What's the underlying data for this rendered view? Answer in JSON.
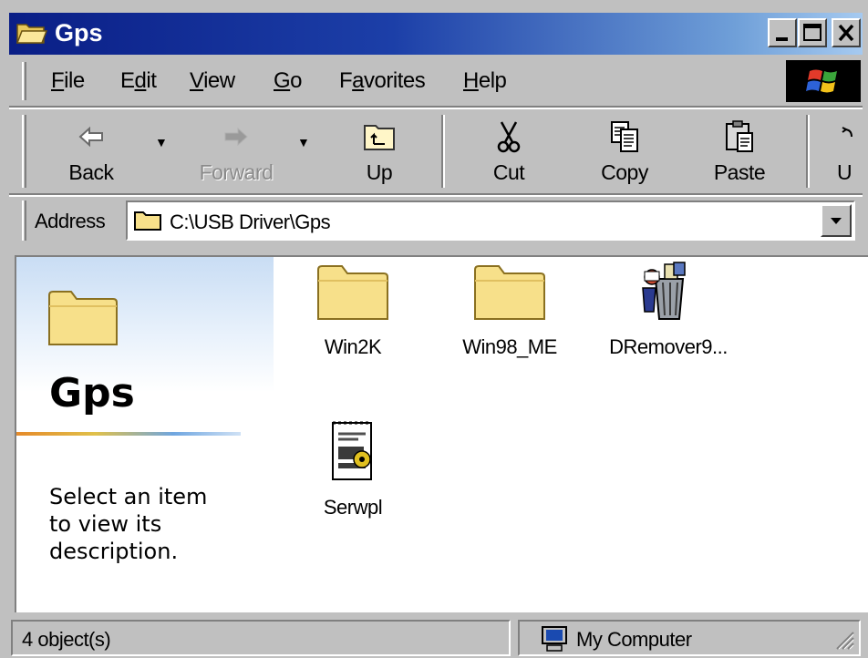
{
  "window": {
    "title": "Gps",
    "controls": [
      "minimize",
      "maximize",
      "close"
    ]
  },
  "menu": {
    "items": [
      {
        "label": "File",
        "mnemonic": "F"
      },
      {
        "label": "Edit",
        "mnemonic": "d"
      },
      {
        "label": "View",
        "mnemonic": "V"
      },
      {
        "label": "Go",
        "mnemonic": "G"
      },
      {
        "label": "Favorites",
        "mnemonic": "a"
      },
      {
        "label": "Help",
        "mnemonic": "H"
      }
    ]
  },
  "toolbar": {
    "back": "Back",
    "forward": "Forward",
    "up": "Up",
    "cut": "Cut",
    "copy": "Copy",
    "paste": "Paste",
    "undo_partial": "U"
  },
  "address": {
    "label": "Address",
    "value": "C:\\USB Driver\\Gps"
  },
  "left_pane": {
    "title": "Gps",
    "description": "Select an item to view its description."
  },
  "files": [
    {
      "name": "Win2K",
      "icon": "folder-icon"
    },
    {
      "name": "Win98_ME",
      "icon": "folder-icon"
    },
    {
      "name": "DRemover9...",
      "icon": "uninstaller-icon"
    },
    {
      "name": "Serwpl",
      "icon": "setup-info-icon"
    }
  ],
  "status": {
    "objects": "4 object(s)",
    "zone": "My Computer"
  },
  "colors": {
    "titlebar_start": "#0a1e86",
    "titlebar_end": "#a6caf0",
    "chrome": "#c0c0c0",
    "folder": "#f7e08a"
  }
}
